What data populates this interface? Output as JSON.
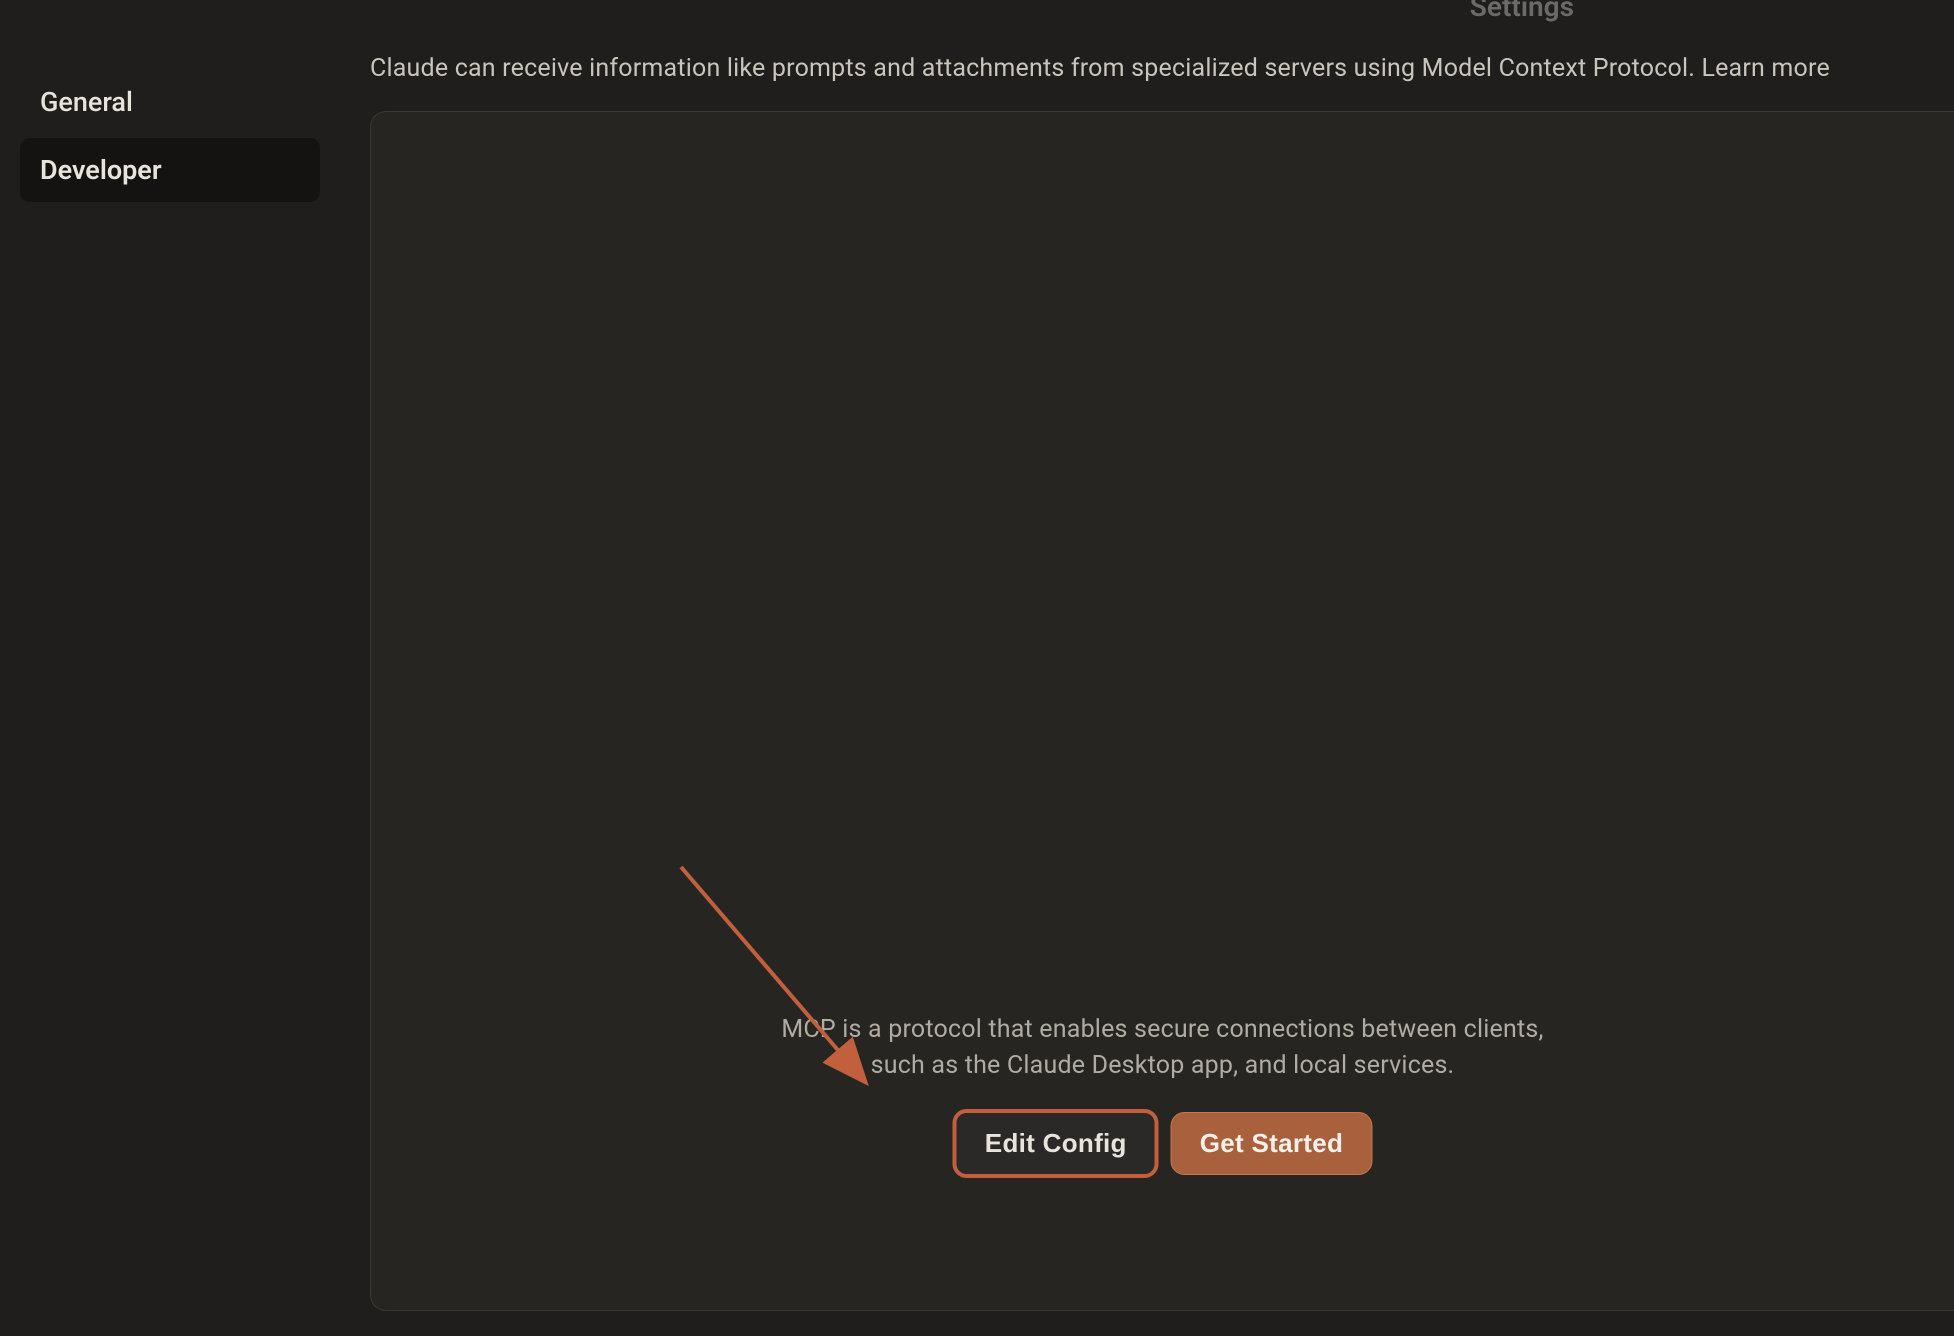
{
  "header": {
    "title": "Settings"
  },
  "sidebar": {
    "items": [
      {
        "label": "General",
        "active": false
      },
      {
        "label": "Developer",
        "active": true
      }
    ]
  },
  "main": {
    "description_prefix": "Claude can receive information like prompts and attachments from specialized servers using Model Context Protocol. ",
    "learn_more_label": "Learn more",
    "mcp_description_line1": "MCP is a protocol that enables secure connections between clients,",
    "mcp_description_line2": "such as the Claude Desktop app, and local services.",
    "edit_config_label": "Edit Config",
    "get_started_label": "Get Started"
  },
  "annotation": {
    "highlight_target": "edit-config-button",
    "highlight_color": "#c25f3c"
  }
}
